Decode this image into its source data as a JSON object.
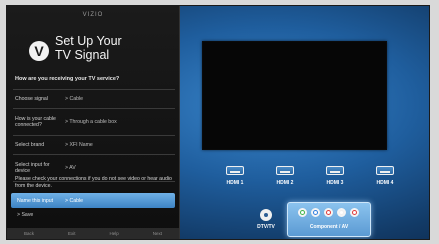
{
  "panel": {
    "header": "VIZIO",
    "title_line1": "Set Up Your",
    "title_line2": "TV Signal",
    "question": "How are you receiving your TV service?",
    "rows": [
      {
        "label": "Choose signal",
        "value": "> Cable"
      },
      {
        "label": "How is your cable connected?",
        "value": "> Through a cable box"
      },
      {
        "label": "Select brand",
        "value": "> XFI Name"
      },
      {
        "label": "Select input for device",
        "value": "> AV"
      }
    ],
    "instructions": "Please check your connections if you do not see video or hear audio from the device.",
    "highlight": {
      "label": "Name this input",
      "value": "> Cable"
    },
    "save_label": "> Save",
    "bottom_bar": [
      "Back",
      "Exit",
      "Help",
      "Next"
    ]
  },
  "inputs": {
    "hdmi": [
      "HDMI 1",
      "HDMI 2",
      "HDMI 3",
      "HDMI 4"
    ],
    "dtv": "DTV/TV",
    "component": "Component / AV",
    "jack_colors": [
      "#3fb54a",
      "#2f7fe0",
      "#e03a3a",
      "#f0f0f0",
      "#e03a3a"
    ]
  }
}
